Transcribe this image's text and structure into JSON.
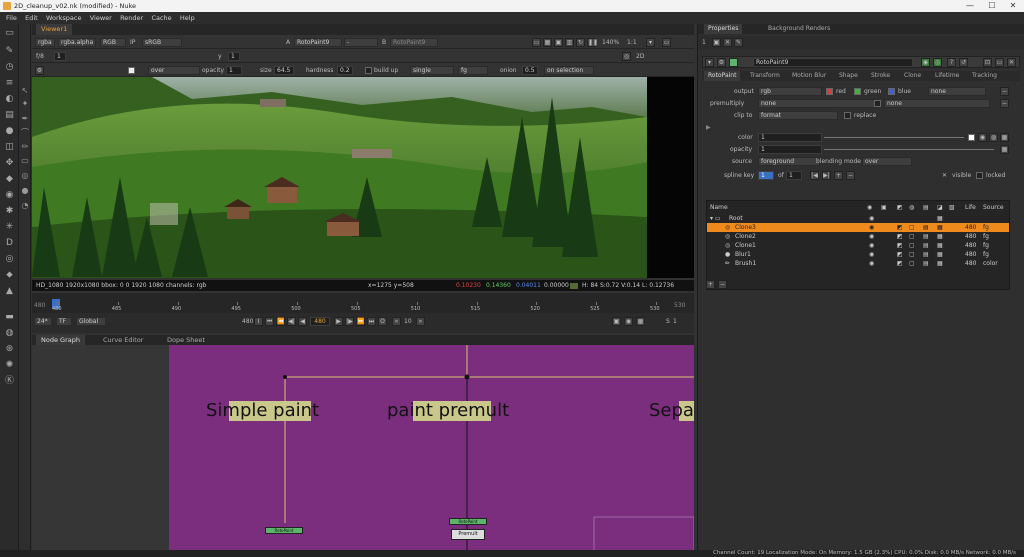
{
  "window": {
    "title": "2D_cleanup_v02.nk (modified) - Nuke",
    "min": "—",
    "max": "☐",
    "close": "✕"
  },
  "menu": [
    "File",
    "Edit",
    "Workspace",
    "Viewer",
    "Render",
    "Cache",
    "Help"
  ],
  "viewer": {
    "tab": "Viewer1",
    "channels": "rgba",
    "alpha": "rgba.alpha",
    "mode": "RGB",
    "ip": "IP",
    "lut": "sRGB",
    "a_label": "A",
    "a_input": "RotoPaint9",
    "dash": "-",
    "b_label": "B",
    "b_input": "RotoPaint9",
    "zoom": "140%",
    "ratio": "1:1",
    "view": "2D",
    "fstop_label": "f/8",
    "fstop_val": "1",
    "y_label": "y",
    "y_val": "1",
    "brush": {
      "merge": "over",
      "opacity_label": "opacity",
      "opacity": "1",
      "size_label": "size",
      "size": "64.5",
      "hardness_label": "hardness",
      "hardness": "0.2",
      "buildup": "build up",
      "lifetime": "single",
      "source": "fg",
      "onion_label": "onion",
      "onion": "0.5",
      "on_selection": "on selection"
    },
    "status": {
      "format": "HD_1080 1920x1080  bbox: 0 0 1920 1080 channels: rgb",
      "coords": "x=1275 y=508",
      "r": "0.10230",
      "g": "0.14360",
      "b": "0.04011",
      "a": "0.00000",
      "hsvl": "H: 84 S:0.72 V:0.14  L: 0.12736"
    }
  },
  "timeline": {
    "start": "480",
    "end": "530",
    "start_mark": "480",
    "end_mark": "530",
    "ticks": [
      "480",
      "485",
      "490",
      "495",
      "500",
      "505",
      "510",
      "515",
      "520",
      "525",
      "530"
    ],
    "fps": "24*",
    "tf": "TF",
    "scope": "Global",
    "frame": "480",
    "step": "10",
    "inc": "10",
    "s": "S",
    "s_val": "1",
    "i": "I",
    "o": "O"
  },
  "nodegraph": {
    "tabs": [
      "Node Graph",
      "Curve Editor",
      "Dope Sheet"
    ],
    "backdrops": [
      "Simple paint",
      "paint premult",
      "Sepa"
    ],
    "nodes": [
      "RotoPaint",
      "RotoPaint",
      "Premult"
    ],
    "bg_color": "#7b2e7e"
  },
  "props": {
    "tabs": [
      "Properties",
      "Background Renders"
    ],
    "count": "1",
    "node_name": "RotoPaint9",
    "subtabs": [
      "RotoPaint",
      "Transform",
      "Motion Blur",
      "Shape",
      "Stroke",
      "Clone",
      "Lifetime",
      "Tracking"
    ],
    "output_label": "output",
    "output": "rgb",
    "red": "red",
    "green": "green",
    "blue": "blue",
    "output_extra": "none",
    "premultiply_label": "premultiply",
    "premultiply": "none",
    "premultiply_extra": "none",
    "clipto_label": "clip to",
    "clipto": "format",
    "replace": "replace",
    "color_label": "color",
    "color": "1",
    "opacity_label": "opacity",
    "opacity": "1",
    "source_label": "source",
    "source": "foreground",
    "blend_label": "blending mode",
    "blend": "over",
    "splinekey_label": "spline key",
    "splinekey": "1",
    "of": "of",
    "splinekey_total": "1",
    "visible": "visible",
    "locked": "locked",
    "columns": [
      "Name",
      "Life",
      "Source"
    ],
    "tree": [
      {
        "name": "Root",
        "life": "",
        "source": ""
      },
      {
        "name": "Clone3",
        "life": "480",
        "source": "fg"
      },
      {
        "name": "Clone2",
        "life": "480",
        "source": "fg"
      },
      {
        "name": "Clone1",
        "life": "480",
        "source": "fg"
      },
      {
        "name": "Blur1",
        "life": "480",
        "source": "fg"
      },
      {
        "name": "Brush1",
        "life": "480",
        "source": "color"
      }
    ],
    "add": "+",
    "remove": "−"
  },
  "statusbar": "Channel Count: 19  Localization Mode: On  Memory: 1.5 GB (2.3%)  CPU: 0.0%  Disk: 0.0 MB/s  Network: 0.0 MB/s",
  "accent": "#e8a33a"
}
